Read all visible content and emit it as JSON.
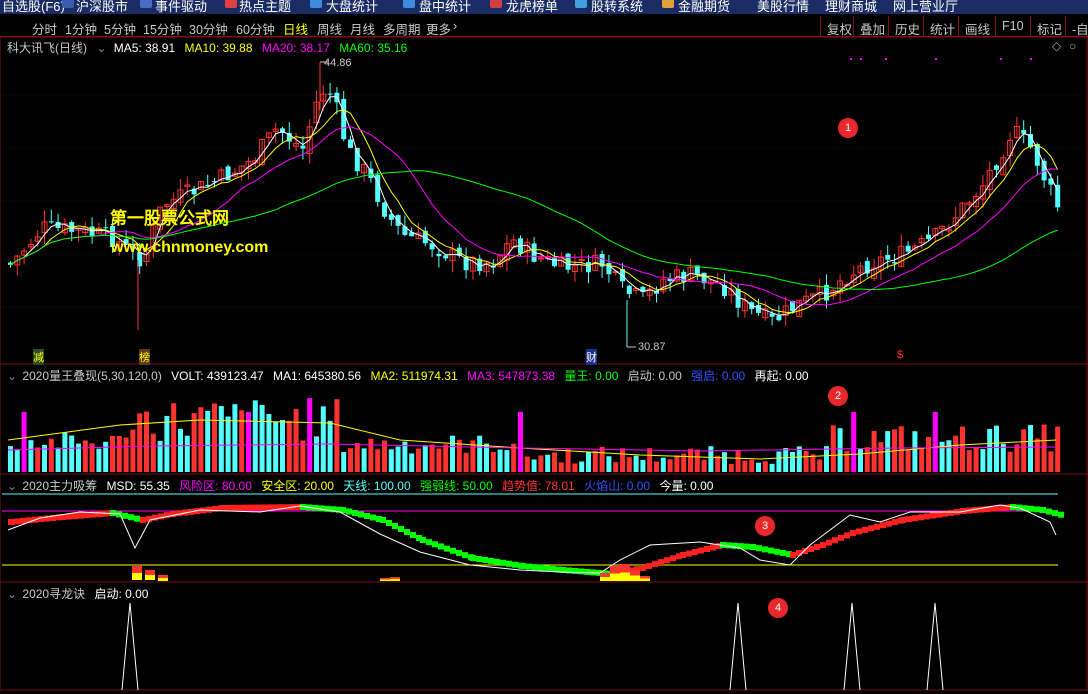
{
  "top_nav": {
    "items": [
      "自选股(F6)",
      "沪深股市",
      "事件驱动",
      "热点主题",
      "大盘统计",
      "盘中统计",
      "龙虎榜单",
      "股转系统",
      "金融期货",
      "美股行情",
      "理财商城",
      "网上营业厅"
    ]
  },
  "period_bar": {
    "periods": [
      "分时",
      "1分钟",
      "5分钟",
      "15分钟",
      "30分钟",
      "60分钟",
      "日线",
      "周线",
      "月线",
      "多周期",
      "更多"
    ],
    "active": "日线",
    "tools": [
      "复权",
      "叠加",
      "历史",
      "统计",
      "画线",
      "F10",
      "标记",
      "-自选"
    ]
  },
  "main_chart": {
    "title": "科大讯飞(日线)",
    "ma5": "MA5: 38.91",
    "ma10": "MA10: 39.88",
    "ma20": "MA20: 38.17",
    "ma60": "MA60: 35.16",
    "high_label": "44.86",
    "low_label": "30.87",
    "events": [
      "减",
      "榜",
      "财",
      "$"
    ],
    "watermark_cn": "第一股票公式网",
    "watermark_url": "www.chnmoney.com",
    "marker": "1"
  },
  "pane2": {
    "title": "2020量王叠现(5,30,120,0)",
    "volt": "VOLT: 439123.47",
    "ma1": "MA1: 645380.56",
    "ma2": "MA2: 511974.31",
    "ma3": "MA3: 547873.38",
    "lw": "量王: 0.00",
    "qd": "启动: 0.00",
    "qq": "强启: 0.00",
    "zq": "再起: 0.00",
    "marker": "2"
  },
  "pane3": {
    "title": "2020主力吸筹",
    "msd": "MSD: 55.35",
    "fxq": "风险区: 80.00",
    "aqq": "安全区: 20.00",
    "tx": "天线: 100.00",
    "qrx": "强弱线: 50.00",
    "qsz": "趋势值: 78.01",
    "hys": "火焰山: 0.00",
    "jl": "今量: 0.00",
    "marker": "3"
  },
  "pane4": {
    "title": "2020寻龙诀",
    "qd": "启动: 0.00",
    "marker": "4"
  },
  "colors": {
    "up": "#ff3232",
    "down": "#54ffff",
    "ma5": "#ffffff",
    "ma10": "#ffff00",
    "ma20": "#ff00ff",
    "ma60": "#00ff00",
    "accent": "#e8282c"
  },
  "icons": [
    "chevron-down-icon",
    "diamond-icon",
    "circle-icon"
  ]
}
